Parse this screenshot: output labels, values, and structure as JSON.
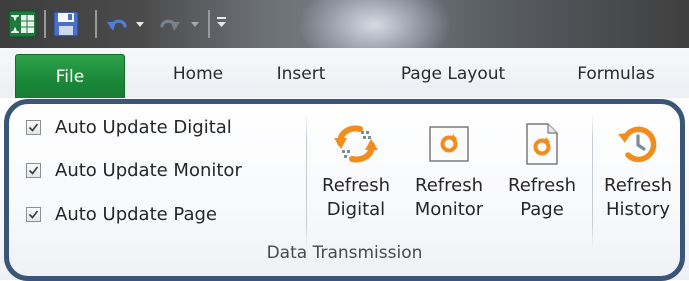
{
  "tabs": {
    "file": "File",
    "home": "Home",
    "insert": "Insert",
    "page_layout": "Page Layout",
    "formulas": "Formulas"
  },
  "group": {
    "label": "Data Transmission",
    "checkboxes": [
      {
        "label": "Auto Update Digital",
        "checked": true
      },
      {
        "label": "Auto Update Monitor",
        "checked": true
      },
      {
        "label": "Auto Update Page",
        "checked": true
      }
    ],
    "buttons": [
      {
        "line1": "Refresh",
        "line2": "Digital",
        "icon": "refresh-digital-icon"
      },
      {
        "line1": "Refresh",
        "line2": "Monitor",
        "icon": "refresh-monitor-icon"
      },
      {
        "line1": "Refresh",
        "line2": "Page",
        "icon": "refresh-page-icon"
      },
      {
        "line1": "Refresh",
        "line2": "History",
        "icon": "refresh-history-icon"
      }
    ]
  },
  "colors": {
    "file_tab": "#1c8a3a",
    "highlight_frame": "#3a5578",
    "icon_orange": "#f28c1c"
  }
}
